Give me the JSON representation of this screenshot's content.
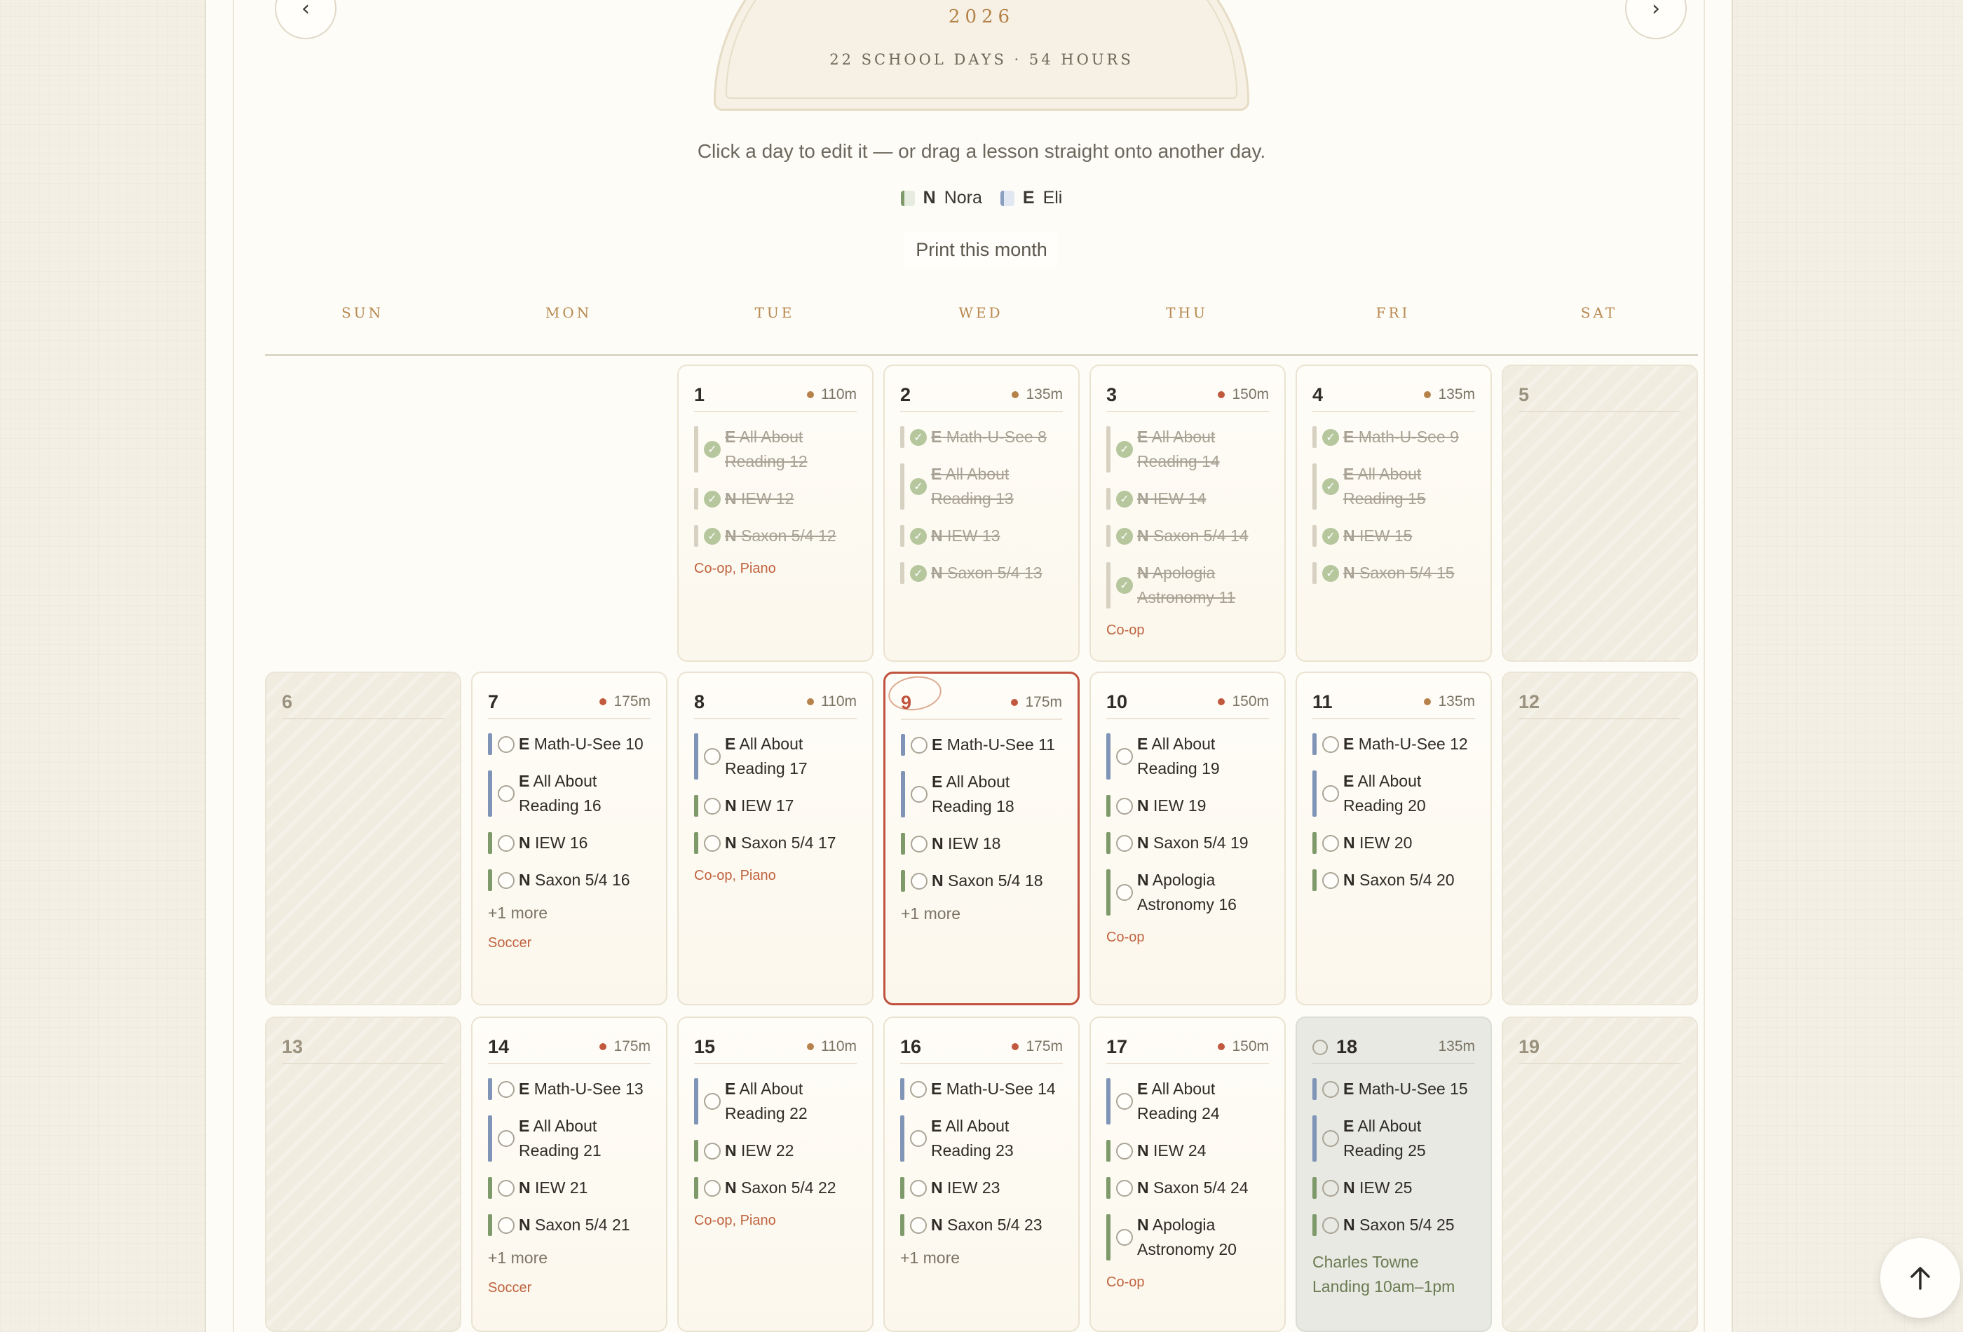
{
  "header": {
    "year": "2026",
    "summary": "22 SCHOOL DAYS · 54 HOURS",
    "prev_icon": "chevron-left-icon",
    "next_icon": "chevron-right-icon"
  },
  "instructions": "Click a day to edit it — or drag a lesson straight onto another day.",
  "legend": [
    {
      "key": "N",
      "name": "Nora",
      "color": "#7e9a6a"
    },
    {
      "key": "E",
      "name": "Eli",
      "color": "#7f94b6"
    }
  ],
  "print_label": "Print this month",
  "weekdays": [
    "SUN",
    "MON",
    "TUE",
    "WED",
    "THU",
    "FRI",
    "SAT"
  ],
  "days": {
    "d1": {
      "num": "1",
      "min": "110m",
      "l1": {
        "k": "E",
        "t": "All About Reading 12"
      },
      "l2": {
        "k": "N",
        "t": "IEW 12"
      },
      "l3": {
        "k": "N",
        "t": "Saxon 5/4 12"
      },
      "act": "Co-op, Piano"
    },
    "d2": {
      "num": "2",
      "min": "135m",
      "l1": {
        "k": "E",
        "t": "Math-U-See 8"
      },
      "l2": {
        "k": "E",
        "t": "All About Reading 13"
      },
      "l3": {
        "k": "N",
        "t": "IEW 13"
      },
      "l4": {
        "k": "N",
        "t": "Saxon 5/4 13"
      }
    },
    "d3": {
      "num": "3",
      "min": "150m",
      "l1": {
        "k": "E",
        "t": "All About Reading 14"
      },
      "l2": {
        "k": "N",
        "t": "IEW 14"
      },
      "l3": {
        "k": "N",
        "t": "Saxon 5/4 14"
      },
      "l4": {
        "k": "N",
        "t": "Apologia Astronomy 11"
      },
      "act": "Co-op"
    },
    "d4": {
      "num": "4",
      "min": "135m",
      "l1": {
        "k": "E",
        "t": "Math-U-See 9"
      },
      "l2": {
        "k": "E",
        "t": "All About Reading 15"
      },
      "l3": {
        "k": "N",
        "t": "IEW 15"
      },
      "l4": {
        "k": "N",
        "t": "Saxon 5/4 15"
      }
    },
    "d5": {
      "num": "5"
    },
    "d6": {
      "num": "6"
    },
    "d7": {
      "num": "7",
      "min": "175m",
      "l1": {
        "k": "E",
        "t": "Math-U-See 10"
      },
      "l2": {
        "k": "E",
        "t": "All About Reading 16"
      },
      "l3": {
        "k": "N",
        "t": "IEW 16"
      },
      "l4": {
        "k": "N",
        "t": "Saxon 5/4 16"
      },
      "more": "+1 more",
      "act": "Soccer"
    },
    "d8": {
      "num": "8",
      "min": "110m",
      "l1": {
        "k": "E",
        "t": "All About Reading 17"
      },
      "l2": {
        "k": "N",
        "t": "IEW 17"
      },
      "l3": {
        "k": "N",
        "t": "Saxon 5/4 17"
      },
      "act": "Co-op, Piano"
    },
    "d9": {
      "num": "9",
      "min": "175m",
      "l1": {
        "k": "E",
        "t": "Math-U-See 11"
      },
      "l2": {
        "k": "E",
        "t": "All About Reading 18"
      },
      "l3": {
        "k": "N",
        "t": "IEW 18"
      },
      "l4": {
        "k": "N",
        "t": "Saxon 5/4 18"
      },
      "more": "+1 more"
    },
    "d10": {
      "num": "10",
      "min": "150m",
      "l1": {
        "k": "E",
        "t": "All About Reading 19"
      },
      "l2": {
        "k": "N",
        "t": "IEW 19"
      },
      "l3": {
        "k": "N",
        "t": "Saxon 5/4 19"
      },
      "l4": {
        "k": "N",
        "t": "Apologia Astronomy 16"
      },
      "act": "Co-op"
    },
    "d11": {
      "num": "11",
      "min": "135m",
      "l1": {
        "k": "E",
        "t": "Math-U-See 12"
      },
      "l2": {
        "k": "E",
        "t": "All About Reading 20"
      },
      "l3": {
        "k": "N",
        "t": "IEW 20"
      },
      "l4": {
        "k": "N",
        "t": "Saxon 5/4 20"
      }
    },
    "d12": {
      "num": "12"
    },
    "d13": {
      "num": "13"
    },
    "d14": {
      "num": "14",
      "min": "175m",
      "l1": {
        "k": "E",
        "t": "Math-U-See 13"
      },
      "l2": {
        "k": "E",
        "t": "All About Reading 21"
      },
      "l3": {
        "k": "N",
        "t": "IEW 21"
      },
      "l4": {
        "k": "N",
        "t": "Saxon 5/4 21"
      },
      "more": "+1 more",
      "act": "Soccer"
    },
    "d15": {
      "num": "15",
      "min": "110m",
      "l1": {
        "k": "E",
        "t": "All About Reading 22"
      },
      "l2": {
        "k": "N",
        "t": "IEW 22"
      },
      "l3": {
        "k": "N",
        "t": "Saxon 5/4 22"
      },
      "act": "Co-op, Piano"
    },
    "d16": {
      "num": "16",
      "min": "175m",
      "l1": {
        "k": "E",
        "t": "Math-U-See 14"
      },
      "l2": {
        "k": "E",
        "t": "All About Reading 23"
      },
      "l3": {
        "k": "N",
        "t": "IEW 23"
      },
      "l4": {
        "k": "N",
        "t": "Saxon 5/4 23"
      },
      "more": "+1 more"
    },
    "d17": {
      "num": "17",
      "min": "150m",
      "l1": {
        "k": "E",
        "t": "All About Reading 24"
      },
      "l2": {
        "k": "N",
        "t": "IEW 24"
      },
      "l3": {
        "k": "N",
        "t": "Saxon 5/4 24"
      },
      "l4": {
        "k": "N",
        "t": "Apologia Astronomy 20"
      },
      "act": "Co-op"
    },
    "d18": {
      "num": "18",
      "min": "135m",
      "l1": {
        "k": "E",
        "t": "Math-U-See 15"
      },
      "l2": {
        "k": "E",
        "t": "All About Reading 25"
      },
      "l3": {
        "k": "N",
        "t": "IEW 25"
      },
      "l4": {
        "k": "N",
        "t": "Saxon 5/4 25"
      },
      "event": "Charles Towne Landing 10am–1pm"
    },
    "d19": {
      "num": "19"
    }
  },
  "scroll_top_icon": "arrow-up-icon"
}
